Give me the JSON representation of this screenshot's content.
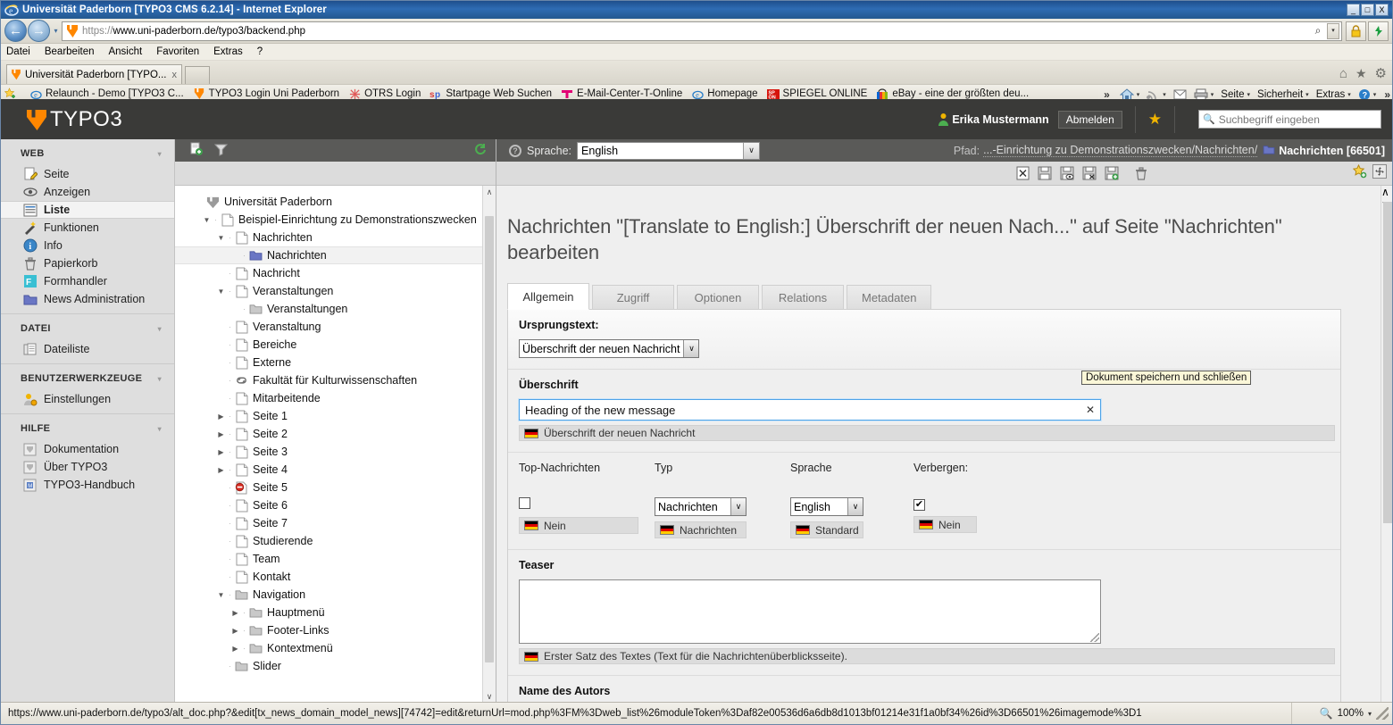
{
  "browser": {
    "window_title": "Universität Paderborn [TYPO3 CMS 6.2.14] - Internet Explorer",
    "minimize_label": "_",
    "maximize_label": "□",
    "close_label": "X",
    "back_label": "←",
    "forward_label": "→",
    "addressbar_dropdown": "▾",
    "url_scheme": "https://",
    "url_rest": "www.uni-paderborn.de/typo3/backend.php",
    "search_glyph": "⌕",
    "lock_glyph": "🔒",
    "refresh_glyph": "↻",
    "menu": [
      {
        "label": "Datei"
      },
      {
        "label": "Bearbeiten"
      },
      {
        "label": "Ansicht"
      },
      {
        "label": "Favoriten"
      },
      {
        "label": "Extras"
      },
      {
        "label": "?"
      }
    ],
    "tab": {
      "label": "Universität Paderborn [TYPO...",
      "close_label": "x"
    },
    "tab_tools": {
      "home": "⌂",
      "favorites": "★",
      "settings": "⚙"
    },
    "favorites": [
      {
        "label": "Relaunch - Demo [TYPO3 C...",
        "icon": "ie-icon"
      },
      {
        "label": "TYPO3 Login Uni Paderborn",
        "icon": "typo3-icon"
      },
      {
        "label": "OTRS  Login",
        "icon": "otrs-icon"
      },
      {
        "label": "Startpage Web Suchen",
        "icon": "startpage-icon"
      },
      {
        "label": "E-Mail-Center-T-Online",
        "icon": "telekom-icon"
      },
      {
        "label": "Homepage",
        "icon": "ie-icon"
      },
      {
        "label": "SPIEGEL ONLINE",
        "icon": "spiegel-icon"
      },
      {
        "label": "eBay - eine der größten deu...",
        "icon": "ebay-icon"
      }
    ],
    "favorites_overflow": "»",
    "commandbar": {
      "overflow": "»",
      "items": [
        {
          "label": "Seite"
        },
        {
          "label": "Sicherheit"
        },
        {
          "label": "Extras"
        }
      ],
      "caret": "▾"
    },
    "statusbar": {
      "url": "https://www.uni-paderborn.de/typo3/alt_doc.php?&edit[tx_news_domain_model_news][74742]=edit&returnUrl=mod.php%3FM%3Dweb_list%26moduleToken%3Daf82e00536d6a6db8d1013bf01214e31f1a0bf34%26id%3D66501%26imagemode%3D1",
      "zoom": "100%",
      "zoom_caret": "▾"
    }
  },
  "topbar": {
    "logo_text": "TYPO3",
    "username": "Erika Mustermann",
    "logout_label": "Abmelden",
    "bookmark_icon": "star-icon",
    "search_placeholder": "Suchbegriff eingeben"
  },
  "modulemenu": {
    "sections": [
      {
        "title": "WEB",
        "collapse": "▾",
        "items": [
          {
            "label": "Seite",
            "icon": "page-edit-icon",
            "active": false
          },
          {
            "label": "Anzeigen",
            "icon": "eye-icon",
            "active": false
          },
          {
            "label": "Liste",
            "icon": "list-icon",
            "active": true
          },
          {
            "label": "Funktionen",
            "icon": "wand-icon",
            "active": false
          },
          {
            "label": "Info",
            "icon": "info-icon",
            "active": false
          },
          {
            "label": "Papierkorb",
            "icon": "trash-icon",
            "active": false
          },
          {
            "label": "Formhandler",
            "icon": "form-icon",
            "active": false
          },
          {
            "label": "News Administration",
            "icon": "folder-icon",
            "active": false
          }
        ]
      },
      {
        "title": "DATEI",
        "collapse": "▾",
        "items": [
          {
            "label": "Dateiliste",
            "icon": "filelist-icon",
            "active": false
          }
        ]
      },
      {
        "title": "BENUTZERWERKZEUGE",
        "collapse": "▾",
        "items": [
          {
            "label": "Einstellungen",
            "icon": "user-settings-icon",
            "active": false
          }
        ]
      },
      {
        "title": "HILFE",
        "collapse": "▾",
        "items": [
          {
            "label": "Dokumentation",
            "icon": "doc-icon",
            "active": false
          },
          {
            "label": "Über TYPO3",
            "icon": "doc-icon",
            "active": false
          },
          {
            "label": "TYPO3-Handbuch",
            "icon": "manual-icon",
            "active": false
          }
        ]
      }
    ]
  },
  "navtoolbar": {
    "new_record_icon": "new-record-icon",
    "filter_icon": "filter-icon",
    "refresh_icon": "refresh-icon"
  },
  "pagetree": {
    "nodes": [
      {
        "label": "Universität Paderborn",
        "depth": 0,
        "toggle": "",
        "icon": "typo3-root-icon",
        "selected": false
      },
      {
        "label": "Beispiel-Einrichtung zu Demonstrationszwecken",
        "depth": 1,
        "toggle": "▼",
        "icon": "page-icon",
        "selected": false
      },
      {
        "label": "Nachrichten",
        "depth": 2,
        "toggle": "▼",
        "icon": "page-icon",
        "selected": false
      },
      {
        "label": "Nachrichten",
        "depth": 3,
        "toggle": "",
        "icon": "folder-blue-icon",
        "selected": true
      },
      {
        "label": "Nachricht",
        "depth": 2,
        "toggle": "",
        "icon": "page-icon",
        "selected": false
      },
      {
        "label": "Veranstaltungen",
        "depth": 2,
        "toggle": "▼",
        "icon": "page-icon",
        "selected": false
      },
      {
        "label": "Veranstaltungen",
        "depth": 3,
        "toggle": "",
        "icon": "folder-icon",
        "selected": false
      },
      {
        "label": "Veranstaltung",
        "depth": 2,
        "toggle": "",
        "icon": "page-icon",
        "selected": false
      },
      {
        "label": "Bereiche",
        "depth": 2,
        "toggle": "",
        "icon": "page-icon",
        "selected": false
      },
      {
        "label": "Externe",
        "depth": 2,
        "toggle": "",
        "icon": "page-icon",
        "selected": false
      },
      {
        "label": "Fakultät für Kulturwissenschaften",
        "depth": 2,
        "toggle": "",
        "icon": "link-icon",
        "selected": false
      },
      {
        "label": "Mitarbeitende",
        "depth": 2,
        "toggle": "",
        "icon": "page-icon",
        "selected": false
      },
      {
        "label": "Seite 1",
        "depth": 2,
        "toggle": "▶",
        "icon": "page-icon",
        "selected": false
      },
      {
        "label": "Seite 2",
        "depth": 2,
        "toggle": "▶",
        "icon": "page-icon",
        "selected": false
      },
      {
        "label": "Seite 3",
        "depth": 2,
        "toggle": "▶",
        "icon": "page-icon",
        "selected": false
      },
      {
        "label": "Seite 4",
        "depth": 2,
        "toggle": "▶",
        "icon": "page-icon",
        "selected": false
      },
      {
        "label": "Seite 5",
        "depth": 2,
        "toggle": "",
        "icon": "page-hidden-icon",
        "selected": false
      },
      {
        "label": "Seite 6",
        "depth": 2,
        "toggle": "",
        "icon": "page-icon",
        "selected": false
      },
      {
        "label": "Seite 7",
        "depth": 2,
        "toggle": "",
        "icon": "page-icon",
        "selected": false
      },
      {
        "label": "Studierende",
        "depth": 2,
        "toggle": "",
        "icon": "page-icon",
        "selected": false
      },
      {
        "label": "Team",
        "depth": 2,
        "toggle": "",
        "icon": "page-icon",
        "selected": false
      },
      {
        "label": "Kontakt",
        "depth": 2,
        "toggle": "",
        "icon": "page-icon",
        "selected": false
      },
      {
        "label": "Navigation",
        "depth": 2,
        "toggle": "▼",
        "icon": "folder-icon",
        "selected": false
      },
      {
        "label": "Hauptmenü",
        "depth": 3,
        "toggle": "▶",
        "icon": "folder-icon",
        "selected": false
      },
      {
        "label": "Footer-Links",
        "depth": 3,
        "toggle": "▶",
        "icon": "folder-icon",
        "selected": false
      },
      {
        "label": "Kontextmenü",
        "depth": 3,
        "toggle": "▶",
        "icon": "folder-icon",
        "selected": false
      },
      {
        "label": "Slider",
        "depth": 2,
        "toggle": "",
        "icon": "folder-icon",
        "selected": false
      }
    ],
    "scroll_up": "∧",
    "scroll_down": "∨"
  },
  "docheader": {
    "help_icon": "question-icon",
    "language_label": "Sprache:",
    "language_value": "English",
    "language_arrow": "∨",
    "path_label": "Pfad:",
    "path_value": "...-Einrichtung zu Demonstrationszwecken/Nachrichten/",
    "page_label": "Nachrichten [66501]",
    "page_icon": "folder-blue-icon",
    "buttons": [
      {
        "name": "close-document-button",
        "icon": "close-icon",
        "glyph": "☒"
      },
      {
        "name": "save-document-button",
        "icon": "save-icon",
        "glyph": ""
      },
      {
        "name": "save-and-view-button",
        "icon": "save-view-icon",
        "glyph": ""
      },
      {
        "name": "save-and-close-button",
        "icon": "save-close-icon",
        "glyph": ""
      },
      {
        "name": "save-and-new-button",
        "icon": "save-new-icon",
        "glyph": ""
      },
      {
        "name": "delete-document-button",
        "icon": "trash-icon",
        "glyph": ""
      }
    ],
    "right_buttons": [
      {
        "name": "add-bookmark-button",
        "icon": "star-plus-icon"
      },
      {
        "name": "fullscreen-button",
        "icon": "fullscreen-icon"
      }
    ]
  },
  "tooltip": {
    "text": "Dokument speichern und schließen"
  },
  "main": {
    "title": "Nachrichten \"[Translate to English:] Überschrift der neuen Nach...\" auf Seite \"Nachrichten\" bearbeiten",
    "tabs": [
      {
        "label": "Allgemein",
        "active": true
      },
      {
        "label": "Zugriff",
        "active": false
      },
      {
        "label": "Optionen",
        "active": false
      },
      {
        "label": "Relations",
        "active": false
      },
      {
        "label": "Metadaten",
        "active": false
      }
    ],
    "fields": {
      "ursprungstext": {
        "label": "Ursprungstext:",
        "value": "Überschrift der neuen Nachricht",
        "arrow": "∨"
      },
      "ueberschrift": {
        "label": "Überschrift",
        "value": "Heading of the new message",
        "clear": "✕",
        "translation_source": "Überschrift der neuen Nachricht",
        "flag": "de-flag-icon"
      },
      "top_nachrichten": {
        "label": "Top-Nachrichten",
        "checked": false,
        "check_glyph": "",
        "translation_source": "Nein",
        "flag": "de-flag-icon"
      },
      "typ": {
        "label": "Typ",
        "value": "Nachrichten",
        "arrow": "∨",
        "translation_source": "Nachrichten",
        "flag": "de-flag-icon"
      },
      "sprache": {
        "label": "Sprache",
        "value": "English",
        "arrow": "∨",
        "translation_source": "Standard",
        "flag": "de-flag-icon"
      },
      "verbergen": {
        "label": "Verbergen:",
        "checked": true,
        "check_glyph": "✔",
        "translation_source": "Nein",
        "flag": "de-flag-icon"
      },
      "teaser": {
        "label": "Teaser",
        "value": "",
        "translation_source": "Erster Satz des Textes (Text für die Nachrichtenüberblicksseite).",
        "flag": "de-flag-icon"
      },
      "autor": {
        "label": "Name des Autors"
      }
    }
  }
}
